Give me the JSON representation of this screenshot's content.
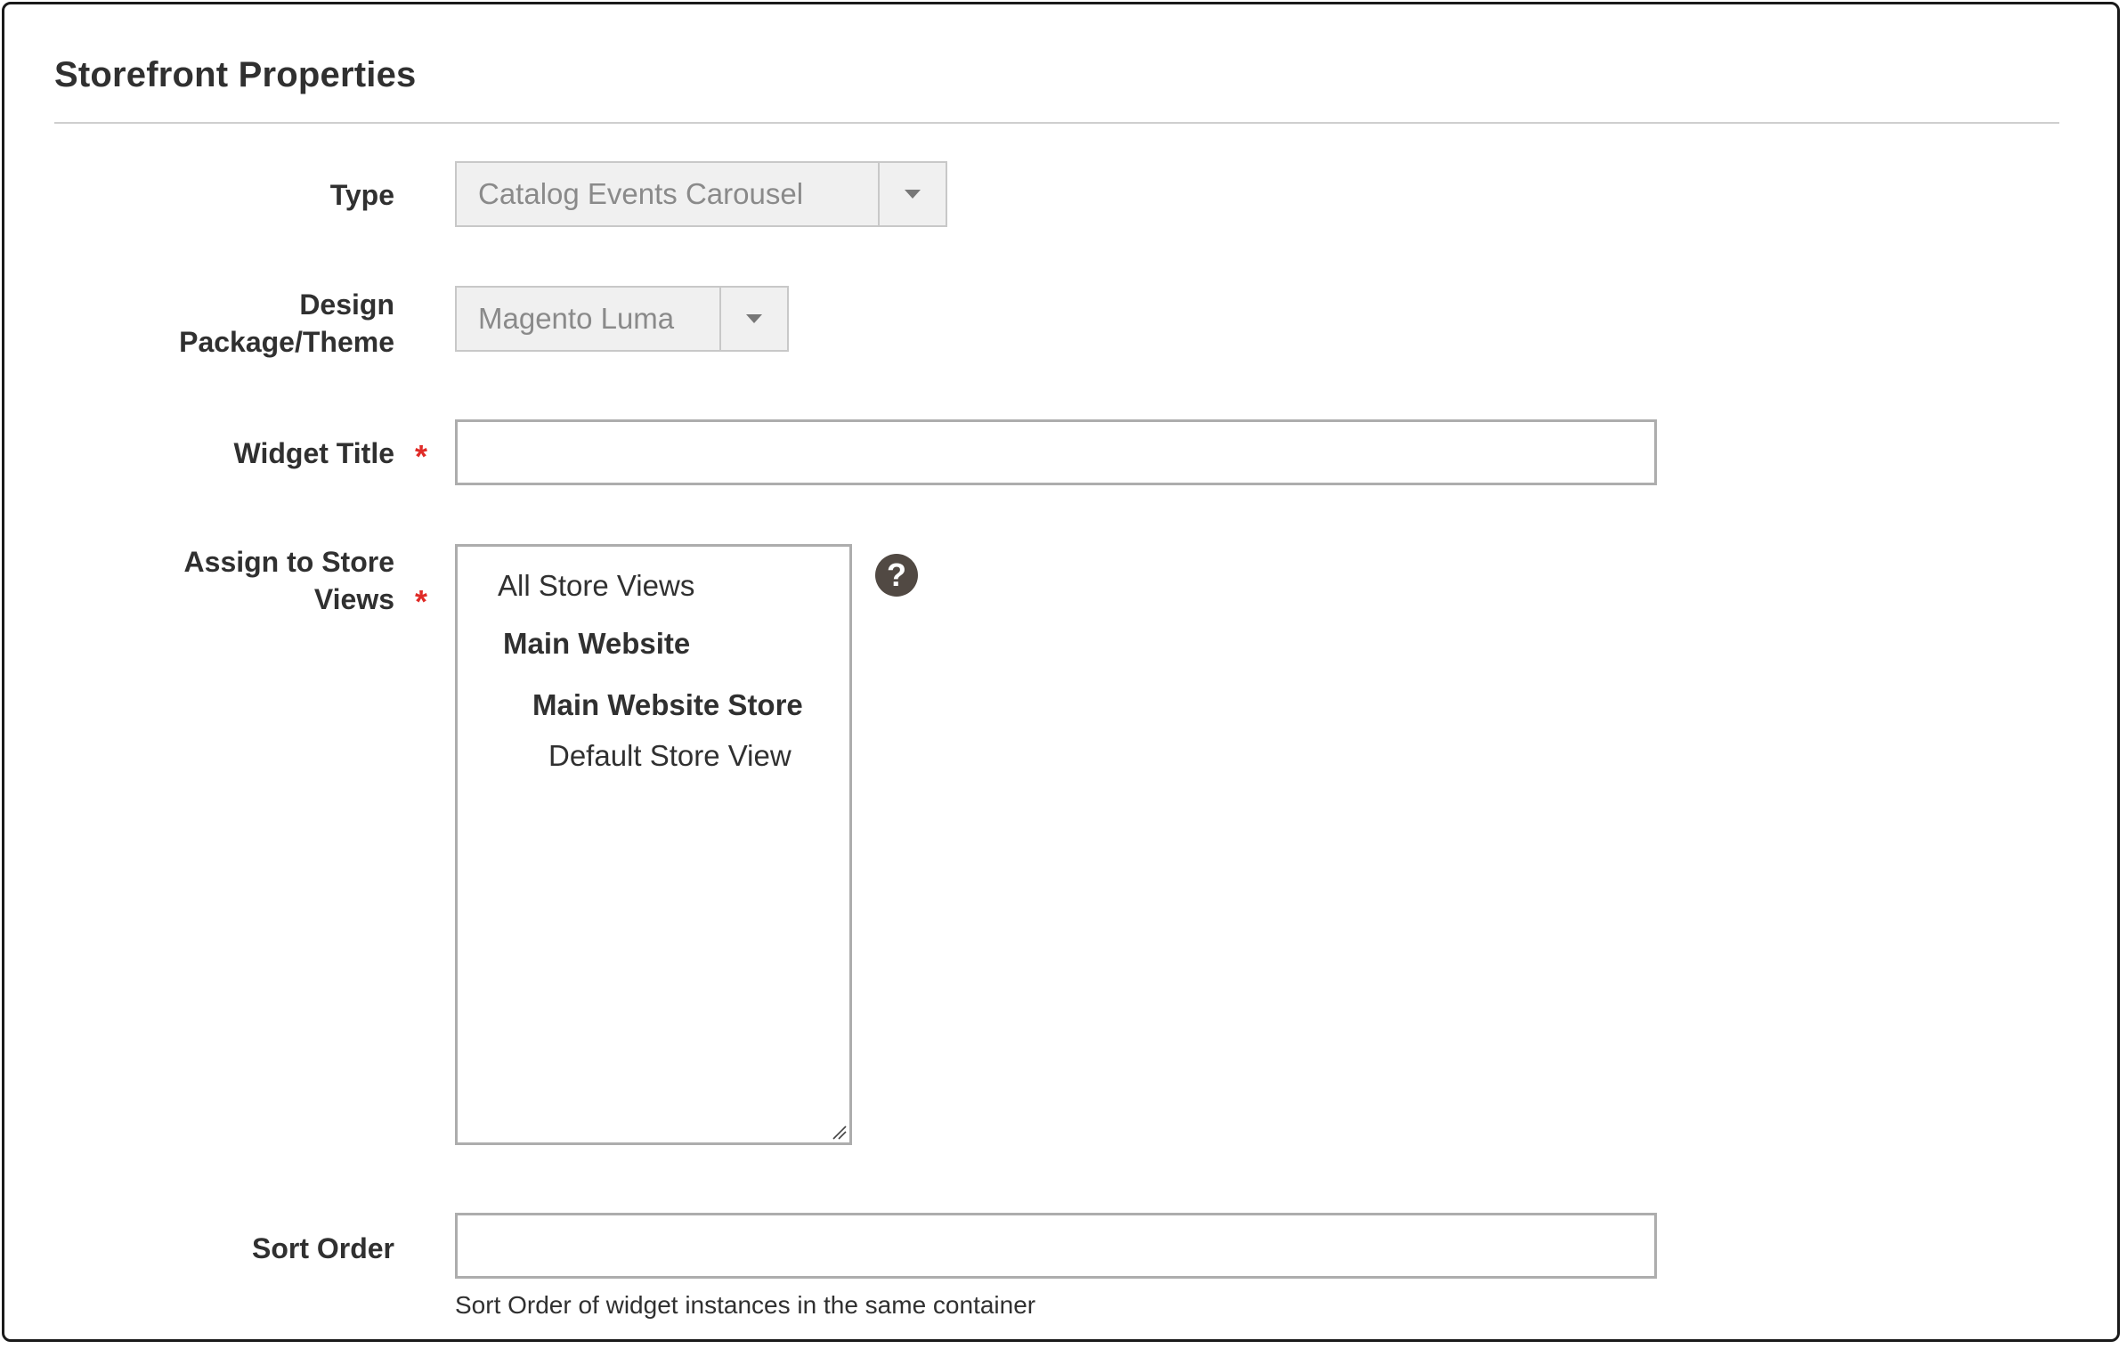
{
  "section": {
    "title": "Storefront Properties"
  },
  "fields": {
    "type": {
      "label": "Type",
      "value": "Catalog Events Carousel"
    },
    "design": {
      "label_line1": "Design",
      "label_line2": "Package/Theme",
      "value": "Magento Luma"
    },
    "widget_title": {
      "label": "Widget Title",
      "required_mark": "*",
      "value": ""
    },
    "store_views": {
      "label_line1": "Assign to Store",
      "label_line2": "Views",
      "required_mark": "*",
      "help_glyph": "?",
      "options": [
        {
          "label": "All Store Views",
          "level": 0,
          "bold": false
        },
        {
          "label": "Main Website",
          "level": 1,
          "bold": true
        },
        {
          "label": "Main Website Store",
          "level": 2,
          "bold": true
        },
        {
          "label": "Default Store View",
          "level": 3,
          "bold": false
        }
      ]
    },
    "sort_order": {
      "label": "Sort Order",
      "value": "",
      "note": "Sort Order of widget instances in the same container"
    }
  },
  "icons": {
    "dropdown": "chevron-down-icon",
    "help": "help-icon",
    "resize": "resize-grip-icon"
  },
  "colors": {
    "required": "#e02b27",
    "help_badge": "#514943",
    "disabled_select_bg": "#f0f0f0"
  }
}
